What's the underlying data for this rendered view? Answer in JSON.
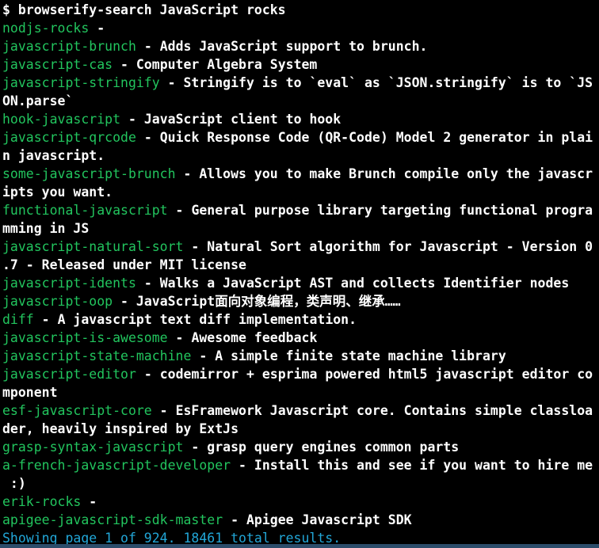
{
  "colors": {
    "background": "#000000",
    "text": "#ffffff",
    "package_name": "#22c55e",
    "status": "#22a7d8"
  },
  "prompt": "$ browserify-search JavaScript rocks",
  "separator": " - ",
  "results": [
    {
      "name": "nodjs-rocks",
      "lines": [
        ""
      ]
    },
    {
      "name": "javascript-brunch",
      "lines": [
        "Adds JavaScript support to brunch."
      ]
    },
    {
      "name": "javascript-cas",
      "lines": [
        "Computer Algebra System"
      ]
    },
    {
      "name": "javascript-stringify",
      "lines": [
        "Stringify is to `eval` as `JSON.stringify` is to `JS",
        "ON.parse`"
      ]
    },
    {
      "name": "hook-javascript",
      "lines": [
        "JavaScript client to hook"
      ]
    },
    {
      "name": "javascript-qrcode",
      "lines": [
        "Quick Response Code (QR-Code) Model 2 generator in plai",
        "n javascript."
      ]
    },
    {
      "name": "some-javascript-brunch",
      "lines": [
        "Allows you to make Brunch compile only the javascr",
        "ipts you want."
      ]
    },
    {
      "name": "functional-javascript",
      "lines": [
        "General purpose library targeting functional progra",
        "mming in JS"
      ]
    },
    {
      "name": "javascript-natural-sort",
      "lines": [
        "Natural Sort algorithm for Javascript - Version 0",
        ".7 - Released under MIT license"
      ]
    },
    {
      "name": "javascript-idents",
      "lines": [
        "Walks a JavaScript AST and collects Identifier nodes"
      ]
    },
    {
      "name": "javascript-oop",
      "lines": [
        "JavaScript面向对象编程，类声明、继承……"
      ]
    },
    {
      "name": "diff",
      "lines": [
        "A javascript text diff implementation."
      ]
    },
    {
      "name": "javascript-is-awesome",
      "lines": [
        "Awesome feedback"
      ]
    },
    {
      "name": "javascript-state-machine",
      "lines": [
        "A simple finite state machine library"
      ]
    },
    {
      "name": "javascript-editor",
      "lines": [
        "codemirror + esprima powered html5 javascript editor co",
        "mponent"
      ]
    },
    {
      "name": "esf-javascript-core",
      "lines": [
        "EsFramework Javascript core. Contains simple classloa",
        "der, heavily inspired by ExtJs"
      ]
    },
    {
      "name": "grasp-syntax-javascript",
      "lines": [
        "grasp query engines common parts"
      ]
    },
    {
      "name": "a-french-javascript-developer",
      "lines": [
        "Install this and see if you want to hire me",
        " :)"
      ]
    },
    {
      "name": "erik-rocks",
      "lines": [
        ""
      ]
    },
    {
      "name": "apigee-javascript-sdk-master",
      "lines": [
        "Apigee Javascript SDK"
      ]
    }
  ],
  "status_line": "Showing page 1 of 924. 18461 total results."
}
